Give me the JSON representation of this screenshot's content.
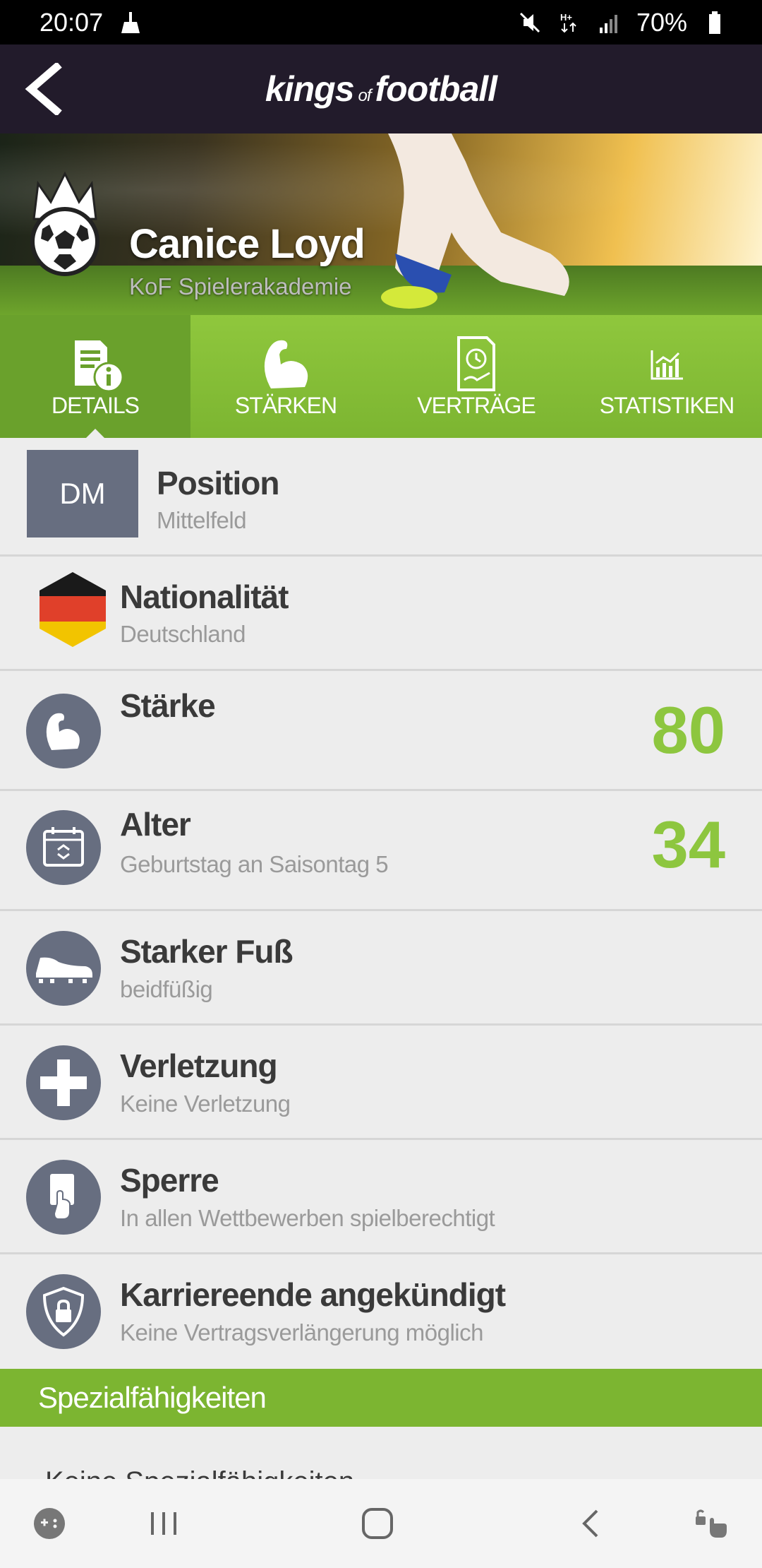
{
  "status_bar": {
    "time": "20:07",
    "battery": "70%",
    "icons": [
      "cleaner-icon",
      "mute-icon",
      "hplus-data-icon",
      "signal-icon",
      "battery-icon"
    ]
  },
  "header": {
    "logo_left": "kings",
    "logo_of": "of",
    "logo_right": "football",
    "back_icon": "chevron-left-icon"
  },
  "player": {
    "name": "Canice Loyd",
    "club": "KoF Spielerakademie"
  },
  "tabs": [
    {
      "label": "DETAILS",
      "icon": "document-info-icon",
      "active": true
    },
    {
      "label": "STÄRKEN",
      "icon": "flexed-arm-icon",
      "active": false
    },
    {
      "label": "VERTRÄGE",
      "icon": "contract-clock-icon",
      "active": false
    },
    {
      "label": "STATISTIKEN",
      "icon": "bar-chart-icon",
      "active": false
    }
  ],
  "details": {
    "position": {
      "badge": "DM",
      "title": "Position",
      "subtitle": "Mittelfeld"
    },
    "nationality": {
      "title": "Nationalität",
      "subtitle": "Deutschland",
      "icon": "german-flag-icon"
    },
    "strength": {
      "title": "Stärke",
      "value": "80",
      "icon": "flexed-arm-icon"
    },
    "age": {
      "title": "Alter",
      "subtitle": "Geburtstag an Saisontag 5",
      "value": "34",
      "icon": "calendar-icon"
    },
    "foot": {
      "title": "Starker Fuß",
      "subtitle": "beidfüßig",
      "icon": "football-boot-icon"
    },
    "injury": {
      "title": "Verletzung",
      "subtitle": "Keine Verletzung",
      "icon": "plus-cross-icon"
    },
    "suspension": {
      "title": "Sperre",
      "subtitle": "In allen Wettbewerben spielberechtigt",
      "icon": "referee-card-icon"
    },
    "career_end": {
      "title": "Karriereende angekündigt",
      "subtitle": "Keine Vertragsverlängerung möglich",
      "icon": "shield-lock-icon"
    }
  },
  "special": {
    "title": "Spezialfähigkeiten",
    "empty_text": "Keine Spezialfähigkeiten"
  },
  "nav_bar": {
    "icons": [
      "game-launcher-icon",
      "recents-icon",
      "home-icon",
      "back-icon",
      "accessibility-icon"
    ]
  },
  "colors": {
    "accent_green": "#8dc63f",
    "header_bg": "#221b2b",
    "icon_slate": "#676e80"
  }
}
